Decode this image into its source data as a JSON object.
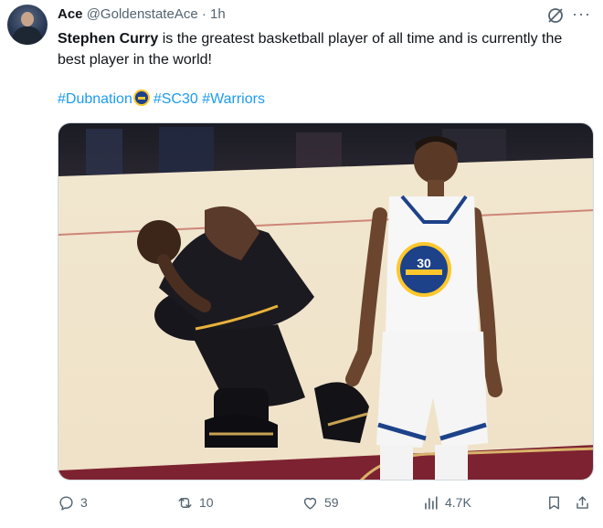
{
  "tweet": {
    "author_name": "Ace",
    "author_handle": "@GoldenstateAce",
    "separator": "·",
    "time": "1h",
    "text_bold": "Stephen Curry",
    "text_rest": " is the greatest basketball player of all time and is currently the best player in the world!",
    "hashtags": [
      "#Dubnation",
      "#SC30",
      "#Warriors"
    ],
    "hashtag_emoji": "warriors-logo-emoji",
    "media_description_icon": "basketball-photo",
    "jersey_number": "30"
  },
  "actions": {
    "replies": "3",
    "reposts": "10",
    "likes": "59",
    "views": "4.7K"
  },
  "colors": {
    "accent": "#1d9bf0",
    "muted": "#536471",
    "text": "#0f1419",
    "border": "#cfd9de"
  }
}
